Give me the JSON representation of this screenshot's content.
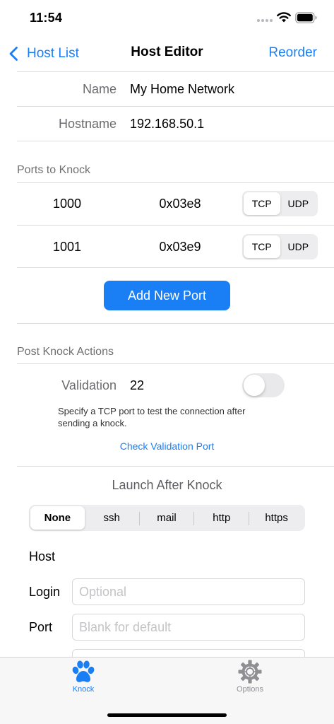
{
  "status_bar": {
    "time": "11:54"
  },
  "nav": {
    "back_label": "Host List",
    "title": "Host Editor",
    "right_label": "Reorder"
  },
  "fields": {
    "name_label": "Name",
    "name_value": "My Home Network",
    "hostname_label": "Hostname",
    "hostname_value": "192.168.50.1"
  },
  "ports_section": {
    "header": "Ports to Knock",
    "ports": [
      {
        "number": "1000",
        "hex": "0x03e8",
        "protocol": "TCP"
      },
      {
        "number": "1001",
        "hex": "0x03e9",
        "protocol": "TCP"
      }
    ],
    "protocol_options": [
      "TCP",
      "UDP"
    ],
    "add_button": "Add New Port"
  },
  "post_knock": {
    "header": "Post Knock Actions",
    "validation_label": "Validation",
    "validation_value": "22",
    "validation_enabled": false,
    "help_text": "Specify a TCP port to test the connection after sending a knock.",
    "check_link": "Check Validation Port"
  },
  "launch": {
    "title": "Launch After Knock",
    "options": [
      "None",
      "ssh",
      "mail",
      "http",
      "https"
    ],
    "selected": "None",
    "host_label": "Host",
    "login_label": "Login",
    "login_placeholder": "Optional",
    "port_label": "Port",
    "port_placeholder": "Blank for default"
  },
  "tab_bar": {
    "tabs": [
      {
        "label": "Knock",
        "icon": "paw-icon",
        "active": true
      },
      {
        "label": "Options",
        "icon": "gear-icon",
        "active": false
      }
    ]
  },
  "colors": {
    "accent": "#1a7ff5",
    "secondary_text": "#6c6c70",
    "tab_inactive": "#8e8e93"
  }
}
